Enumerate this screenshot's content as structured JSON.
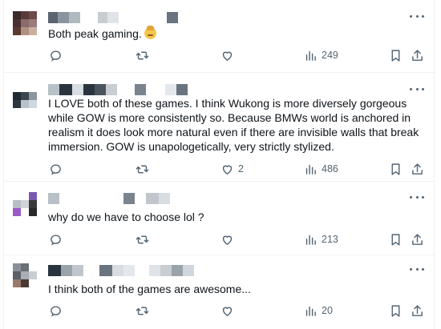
{
  "posts": [
    {
      "text": "Both peak gaming.",
      "emoji": "cowboy-face-emoji",
      "reply_count": "",
      "repost_count": "",
      "like_count": "",
      "view_count": "249"
    },
    {
      "text": "I LOVE both of these games. I think Wukong is more diversely gorgeous while GOW is more consistently so.  Because BMWs world is anchored in realism it does look more natural even if there are invisible walls that break immersion. GOW is unapologetically, very strictly stylized.",
      "reply_count": "",
      "repost_count": "",
      "like_count": "2",
      "view_count": "486"
    },
    {
      "text": "why do we have to choose lol ?",
      "reply_count": "",
      "repost_count": "",
      "like_count": "",
      "view_count": "213"
    },
    {
      "text": "I think both of the games are awesome...",
      "reply_count": "",
      "repost_count": "",
      "like_count": "",
      "view_count": "20"
    }
  ],
  "colors": {
    "icon_gray": "#536471",
    "text": "#0f1419",
    "divider": "#eff3f4"
  },
  "icons": [
    "reply-icon",
    "repost-icon",
    "like-icon",
    "views-icon",
    "bookmark-icon",
    "share-icon",
    "more-icon"
  ]
}
